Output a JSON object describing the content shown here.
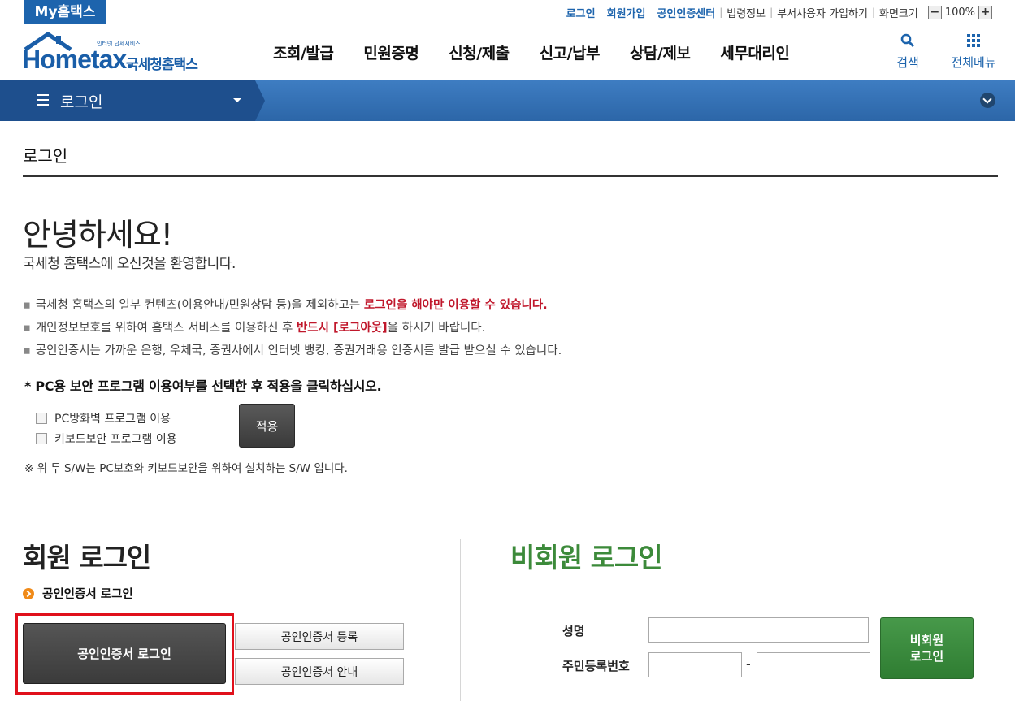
{
  "top": {
    "my_tab": "My홈택스",
    "links": [
      "로그인",
      "회원가입",
      "공인인증센터"
    ],
    "plain_links": [
      "법령정보",
      "부서사용자 가입하기",
      "화면크기"
    ],
    "zoom_minus": "−",
    "zoom_value": "100%",
    "zoom_plus": "+"
  },
  "header": {
    "logo_brand": "Hometax.",
    "logo_korean": "국세청홈택스",
    "logo_tagline": "인터넷 납세서비스",
    "menu": [
      "조회/발급",
      "민원증명",
      "신청/제출",
      "신고/납부",
      "상담/제보",
      "세무대리인"
    ],
    "search_label": "검색",
    "all_menu_label": "전체메뉴"
  },
  "navbar": {
    "current": "로그인"
  },
  "content": {
    "page_title": "로그인",
    "hello": "안녕하세요!",
    "welcome": "국세청 홈택스에 오신것을 환영합니다.",
    "notes": {
      "n1_pre": "국세청 홈택스의 일부 컨텐츠(이용안내/민원상담 등)을 제외하고는 ",
      "n1_hi": "로그인을 해야만 이용할 수 있습니다.",
      "n2_pre": "개인정보보호를 위하여 홈택스 서비스를 이용하신 후 ",
      "n2_hi": "반드시 [로그아웃]",
      "n2_post": "을 하시기 바랍니다.",
      "n3": "공인인증서는 가까운 은행, 우체국, 증권사에서 인터넷 뱅킹, 증권거래용 인증서를 발급 받으실 수 있습니다."
    },
    "pc_title": "* PC용 보안 프로그램 이용여부를 선택한 후 적용을 클릭하십시오.",
    "check1": "PC방화벽 프로그램 이용",
    "check2": "키보드보안 프로그램 이용",
    "apply": "적용",
    "sw_note": "※ 위 두 S/W는 PC보호와 키보드보안을 위하여 설치하는 S/W 입니다."
  },
  "member": {
    "title": "회원 로그인",
    "cert_sub": "공인인증서 로그인",
    "cert_login": "공인인증서 로그인",
    "cert_register": "공인인증서 등록",
    "cert_guide": "공인인증서 안내"
  },
  "guest": {
    "title": "비회원 로그인",
    "name_label": "성명",
    "rrn_label": "주민등록번호",
    "dash": "-",
    "button": "비회원\n로그인"
  },
  "colors": {
    "brand_blue": "#1d64ad",
    "nav_dark": "#1e4f8d",
    "highlight_red": "#c0172b",
    "guest_green": "#3c8a3a",
    "frame_red": "#e0101b"
  }
}
